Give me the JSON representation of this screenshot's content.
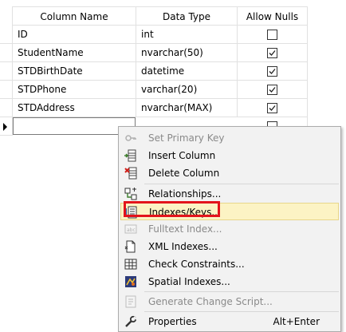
{
  "table": {
    "headers": [
      "Column Name",
      "Data Type",
      "Allow Nulls"
    ],
    "rows": [
      {
        "name": "ID",
        "type": "int",
        "allow_nulls": false
      },
      {
        "name": "StudentName",
        "type": "nvarchar(50)",
        "allow_nulls": true
      },
      {
        "name": "STDBirthDate",
        "type": "datetime",
        "allow_nulls": true
      },
      {
        "name": "STDPhone",
        "type": "varchar(20)",
        "allow_nulls": true
      },
      {
        "name": "STDAddress",
        "type": "nvarchar(MAX)",
        "allow_nulls": true
      }
    ],
    "new_row": {
      "name": "",
      "type": "",
      "allow_nulls": false
    }
  },
  "context_menu": {
    "items": [
      {
        "label": "Set Primary Key",
        "icon": "key-icon",
        "disabled": true
      },
      {
        "label": "Insert Column",
        "icon": "insert-column-icon",
        "disabled": false
      },
      {
        "label": "Delete Column",
        "icon": "delete-column-icon",
        "disabled": false
      },
      {
        "label": "Relationships...",
        "icon": "relationships-icon",
        "disabled": false
      },
      {
        "label": "Indexes/Keys...",
        "icon": "indexes-keys-icon",
        "disabled": false,
        "highlighted": true
      },
      {
        "label": "Fulltext Index...",
        "icon": "fulltext-index-icon",
        "disabled": true
      },
      {
        "label": "XML Indexes...",
        "icon": "xml-indexes-icon",
        "disabled": false
      },
      {
        "label": "Check Constraints...",
        "icon": "check-constraints-icon",
        "disabled": false
      },
      {
        "label": "Spatial Indexes...",
        "icon": "spatial-indexes-icon",
        "disabled": false
      },
      {
        "label": "Generate Change Script...",
        "icon": "generate-script-icon",
        "disabled": true
      },
      {
        "label": "Properties",
        "icon": "wrench-icon",
        "disabled": false,
        "shortcut": "Alt+Enter"
      }
    ]
  },
  "colors": {
    "highlight": "#fcf3c4",
    "annotation": "#e3141c",
    "menu_bg": "#f2f2f2"
  }
}
